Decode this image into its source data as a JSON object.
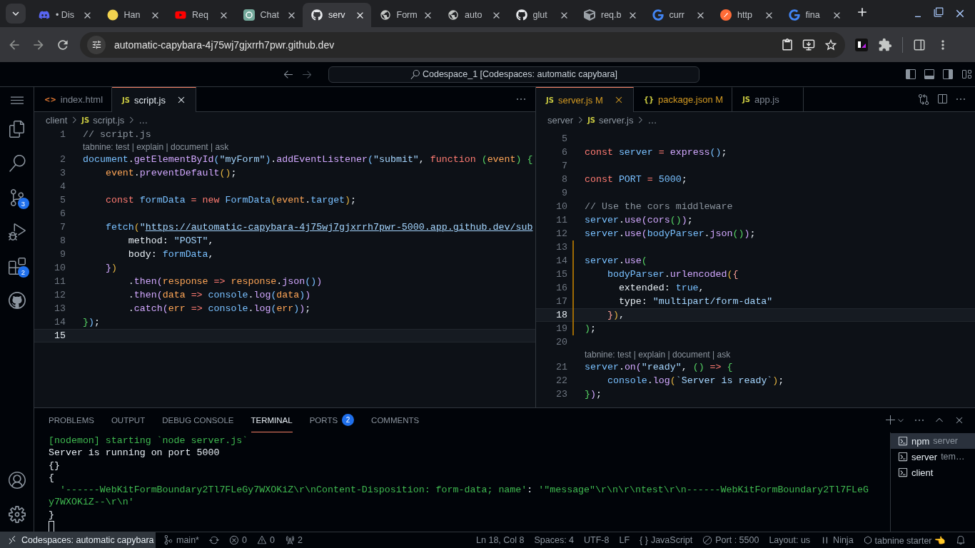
{
  "browser": {
    "tabs": [
      {
        "kind": "discord",
        "title": "• Dis",
        "selected": false
      },
      {
        "kind": "emoji",
        "title": "Han",
        "selected": false
      },
      {
        "kind": "youtube",
        "title": "Req",
        "selected": false
      },
      {
        "kind": "chat",
        "title": "Chat",
        "selected": false
      },
      {
        "kind": "github",
        "title": "serv",
        "selected": true
      },
      {
        "kind": "globe",
        "title": "Form",
        "selected": false
      },
      {
        "kind": "globe",
        "title": "auto",
        "selected": false
      },
      {
        "kind": "github",
        "title": "glut",
        "selected": false
      },
      {
        "kind": "cube",
        "title": "req.b",
        "selected": false
      },
      {
        "kind": "google",
        "title": "curr",
        "selected": false
      },
      {
        "kind": "postman",
        "title": "http",
        "selected": false
      },
      {
        "kind": "google",
        "title": "fina",
        "selected": false
      }
    ],
    "url": "automatic-capybara-4j75wj7gjxrrh7pwr.github.dev"
  },
  "titlebar": {
    "command_center": "Codespace_1 [Codespaces: automatic capybara]"
  },
  "activity_bar": {
    "top": [
      {
        "kind": "menu"
      },
      {
        "kind": "explorer"
      },
      {
        "kind": "search"
      },
      {
        "kind": "scm",
        "badge": "3"
      },
      {
        "kind": "debug"
      },
      {
        "kind": "extensions",
        "badge": "2"
      },
      {
        "kind": "github"
      }
    ],
    "bottom": [
      {
        "kind": "account"
      },
      {
        "kind": "settings"
      }
    ]
  },
  "editors": [
    {
      "tabs": [
        {
          "kind": "html",
          "icon": "<>",
          "label": "index.html",
          "selected": false
        },
        {
          "kind": "js",
          "icon": "JS",
          "label": "script.js",
          "selected": true
        }
      ],
      "breadcrumb": [
        {
          "text": "client"
        },
        {
          "icon": "JS",
          "text": "script.js"
        },
        {
          "text": "…"
        }
      ],
      "lines": [
        {
          "kind": "code",
          "number": "1",
          "current": false,
          "modified": false,
          "tokens": [
            {
              "text": "// script.js",
              "kind": "comment"
            }
          ]
        },
        {
          "kind": "lens",
          "text": "tabnine: test | explain | document | ask"
        },
        {
          "kind": "code",
          "number": "2",
          "current": false,
          "modified": false,
          "tokens": [
            {
              "text": "document",
              "kind": "var"
            },
            {
              "text": ".",
              "kind": "plain"
            },
            {
              "text": "getElementById",
              "kind": "func"
            },
            {
              "text": "(",
              "kind": "bracket1"
            },
            {
              "text": "\"myForm\"",
              "kind": "string"
            },
            {
              "text": ")",
              "kind": "bracket1"
            },
            {
              "text": ".",
              "kind": "plain"
            },
            {
              "text": "addEventListener",
              "kind": "func"
            },
            {
              "text": "(",
              "kind": "bracket1"
            },
            {
              "text": "\"submit\"",
              "kind": "string"
            },
            {
              "text": ", ",
              "kind": "plain"
            },
            {
              "text": "function ",
              "kind": "keyword"
            },
            {
              "text": "(",
              "kind": "bracket2"
            },
            {
              "text": "event",
              "kind": "param"
            },
            {
              "text": ") {",
              "kind": "bracket2"
            }
          ]
        },
        {
          "kind": "code",
          "number": "3",
          "current": false,
          "modified": false,
          "tokens": [
            {
              "text": "    event",
              "kind": "param"
            },
            {
              "text": ".",
              "kind": "plain"
            },
            {
              "text": "preventDefault",
              "kind": "func"
            },
            {
              "text": "()",
              "kind": "bracket3"
            },
            {
              "text": ";",
              "kind": "plain"
            }
          ]
        },
        {
          "kind": "code",
          "number": "4",
          "current": false,
          "modified": false
        },
        {
          "kind": "code",
          "number": "5",
          "current": false,
          "modified": false,
          "tokens": [
            {
              "text": "    const ",
              "kind": "keyword"
            },
            {
              "text": "formData",
              "kind": "var"
            },
            {
              "text": " = new ",
              "kind": "keyword"
            },
            {
              "text": "FormData",
              "kind": "var"
            },
            {
              "text": "(",
              "kind": "bracket3"
            },
            {
              "text": "event",
              "kind": "param"
            },
            {
              "text": ".",
              "kind": "plain"
            },
            {
              "text": "target",
              "kind": "var"
            },
            {
              "text": ")",
              "kind": "bracket3"
            },
            {
              "text": ";",
              "kind": "plain"
            }
          ]
        },
        {
          "kind": "code",
          "number": "6",
          "current": false,
          "modified": false
        },
        {
          "kind": "code",
          "number": "7",
          "current": false,
          "modified": false,
          "tokens": [
            {
              "text": "    fetch",
              "kind": "var"
            },
            {
              "text": "(",
              "kind": "bracket3"
            },
            {
              "text": "\"",
              "kind": "string"
            },
            {
              "text": "https://automatic-capybara-4j75wj7gjxrrh7pwr-5000.app.github.dev/sub",
              "kind": "link"
            }
          ]
        },
        {
          "kind": "code",
          "number": "8",
          "current": false,
          "modified": false,
          "tokens": [
            {
              "text": "        method: ",
              "kind": "plain"
            },
            {
              "text": "\"POST\"",
              "kind": "string"
            },
            {
              "text": ",",
              "kind": "plain"
            }
          ]
        },
        {
          "kind": "code",
          "number": "9",
          "current": false,
          "modified": false,
          "tokens": [
            {
              "text": "        body: ",
              "kind": "plain"
            },
            {
              "text": "formData",
              "kind": "var"
            },
            {
              "text": ",",
              "kind": "plain"
            }
          ]
        },
        {
          "kind": "code",
          "number": "10",
          "current": false,
          "modified": false,
          "tokens": [
            {
              "text": "    }",
              "kind": "bracket5"
            },
            {
              "text": ")",
              "kind": "bracket3"
            }
          ]
        },
        {
          "kind": "code",
          "number": "11",
          "current": false,
          "modified": false,
          "tokens": [
            {
              "text": "        .",
              "kind": "plain"
            },
            {
              "text": "then",
              "kind": "func"
            },
            {
              "text": "(",
              "kind": "bracket5"
            },
            {
              "text": "response",
              "kind": "param"
            },
            {
              "text": " => ",
              "kind": "keyword"
            },
            {
              "text": "response",
              "kind": "param"
            },
            {
              "text": ".",
              "kind": "plain"
            },
            {
              "text": "json",
              "kind": "func"
            },
            {
              "text": "()",
              "kind": "bracket1"
            },
            {
              "text": ")",
              "kind": "bracket5"
            }
          ]
        },
        {
          "kind": "code",
          "number": "12",
          "current": false,
          "modified": false,
          "tokens": [
            {
              "text": "        .",
              "kind": "plain"
            },
            {
              "text": "then",
              "kind": "func"
            },
            {
              "text": "(",
              "kind": "bracket5"
            },
            {
              "text": "data",
              "kind": "param"
            },
            {
              "text": " => ",
              "kind": "keyword"
            },
            {
              "text": "console",
              "kind": "var"
            },
            {
              "text": ".",
              "kind": "plain"
            },
            {
              "text": "log",
              "kind": "func"
            },
            {
              "text": "(",
              "kind": "bracket1"
            },
            {
              "text": "data",
              "kind": "param"
            },
            {
              "text": ")",
              "kind": "bracket1"
            },
            {
              "text": ")",
              "kind": "bracket5"
            }
          ]
        },
        {
          "kind": "code",
          "number": "13",
          "current": false,
          "modified": false,
          "tokens": [
            {
              "text": "        .",
              "kind": "plain"
            },
            {
              "text": "catch",
              "kind": "func"
            },
            {
              "text": "(",
              "kind": "bracket5"
            },
            {
              "text": "err",
              "kind": "param"
            },
            {
              "text": " => ",
              "kind": "keyword"
            },
            {
              "text": "console",
              "kind": "var"
            },
            {
              "text": ".",
              "kind": "plain"
            },
            {
              "text": "log",
              "kind": "func"
            },
            {
              "text": "(",
              "kind": "bracket1"
            },
            {
              "text": "err",
              "kind": "param"
            },
            {
              "text": ")",
              "kind": "bracket1"
            },
            {
              "text": ")",
              "kind": "bracket5"
            },
            {
              "text": ";",
              "kind": "plain"
            }
          ]
        },
        {
          "kind": "code",
          "number": "14",
          "current": false,
          "modified": false,
          "tokens": [
            {
              "text": "}",
              "kind": "bracket2"
            },
            {
              "text": ")",
              "kind": "bracket1"
            },
            {
              "text": ";",
              "kind": "plain"
            }
          ]
        },
        {
          "kind": "code",
          "number": "15",
          "current": true,
          "modified": false
        }
      ]
    },
    {
      "tabs": [
        {
          "kind": "js",
          "icon": "JS",
          "label": "server.js",
          "status": "M",
          "selected": true
        },
        {
          "kind": "json",
          "icon": "{}",
          "label": "package.json",
          "status": "M",
          "selected": false
        },
        {
          "kind": "js",
          "icon": "JS",
          "label": "app.js",
          "selected": false
        }
      ],
      "breadcrumb": [
        {
          "text": "server"
        },
        {
          "icon": "JS",
          "text": "server.js"
        },
        {
          "text": "…"
        }
      ],
      "lines": [
        {
          "kind": "code",
          "number": "5",
          "current": false,
          "modified": false
        },
        {
          "kind": "code",
          "number": "6",
          "current": false,
          "modified": false,
          "tokens": [
            {
              "text": "const ",
              "kind": "keyword"
            },
            {
              "text": "server",
              "kind": "var"
            },
            {
              "text": " = ",
              "kind": "keyword"
            },
            {
              "text": "express",
              "kind": "func"
            },
            {
              "text": "()",
              "kind": "bracket1"
            },
            {
              "text": ";",
              "kind": "plain"
            }
          ]
        },
        {
          "kind": "code",
          "number": "7",
          "current": false,
          "modified": false
        },
        {
          "kind": "code",
          "number": "8",
          "current": false,
          "modified": false,
          "tokens": [
            {
              "text": "const ",
              "kind": "keyword"
            },
            {
              "text": "PORT",
              "kind": "var"
            },
            {
              "text": " = ",
              "kind": "keyword"
            },
            {
              "text": "5000",
              "kind": "var"
            },
            {
              "text": ";",
              "kind": "plain"
            }
          ]
        },
        {
          "kind": "code",
          "number": "9",
          "current": false,
          "modified": false
        },
        {
          "kind": "code",
          "number": "10",
          "current": false,
          "modified": false,
          "tokens": [
            {
              "text": "// Use the cors middleware",
              "kind": "comment"
            }
          ]
        },
        {
          "kind": "code",
          "number": "11",
          "current": false,
          "modified": false,
          "tokens": [
            {
              "text": "server",
              "kind": "var"
            },
            {
              "text": ".",
              "kind": "plain"
            },
            {
              "text": "use",
              "kind": "func"
            },
            {
              "text": "(",
              "kind": "bracket5"
            },
            {
              "text": "cors",
              "kind": "func"
            },
            {
              "text": "()",
              "kind": "bracket2"
            },
            {
              "text": ")",
              "kind": "bracket5"
            },
            {
              "text": ";",
              "kind": "plain"
            }
          ]
        },
        {
          "kind": "code",
          "number": "12",
          "current": false,
          "modified": false,
          "tokens": [
            {
              "text": "server",
              "kind": "var"
            },
            {
              "text": ".",
              "kind": "plain"
            },
            {
              "text": "use",
              "kind": "func"
            },
            {
              "text": "(",
              "kind": "bracket5"
            },
            {
              "text": "bodyParser",
              "kind": "var"
            },
            {
              "text": ".",
              "kind": "plain"
            },
            {
              "text": "json",
              "kind": "func"
            },
            {
              "text": "()",
              "kind": "bracket2"
            },
            {
              "text": ")",
              "kind": "bracket5"
            },
            {
              "text": ";",
              "kind": "plain"
            }
          ]
        },
        {
          "kind": "code",
          "number": "13",
          "current": false,
          "modified": true
        },
        {
          "kind": "code",
          "number": "14",
          "current": false,
          "modified": true,
          "tokens": [
            {
              "text": "server",
              "kind": "var"
            },
            {
              "text": ".",
              "kind": "plain"
            },
            {
              "text": "use",
              "kind": "func"
            },
            {
              "text": "(",
              "kind": "bracket2"
            }
          ]
        },
        {
          "kind": "code",
          "number": "15",
          "current": false,
          "modified": true,
          "tokens": [
            {
              "text": "    bodyParser",
              "kind": "var"
            },
            {
              "text": ".",
              "kind": "plain"
            },
            {
              "text": "urlencoded",
              "kind": "func"
            },
            {
              "text": "(",
              "kind": "bracket3"
            },
            {
              "text": "{",
              "kind": "bracket4"
            }
          ]
        },
        {
          "kind": "code",
          "number": "16",
          "current": false,
          "modified": true,
          "tokens": [
            {
              "text": "      extended: ",
              "kind": "plain"
            },
            {
              "text": "true",
              "kind": "var"
            },
            {
              "text": ",",
              "kind": "plain"
            }
          ]
        },
        {
          "kind": "code",
          "number": "17",
          "current": false,
          "modified": true,
          "tokens": [
            {
              "text": "      type: ",
              "kind": "plain"
            },
            {
              "text": "\"multipart/form-data\"",
              "kind": "string"
            }
          ]
        },
        {
          "kind": "code",
          "number": "18",
          "current": true,
          "modified": true,
          "tokens": [
            {
              "text": "    }",
              "kind": "bracket4"
            },
            {
              "text": ")",
              "kind": "bracket3"
            },
            {
              "text": ",",
              "kind": "plain"
            }
          ]
        },
        {
          "kind": "code",
          "number": "19",
          "current": false,
          "modified": true,
          "tokens": [
            {
              "text": ")",
              "kind": "bracket2"
            },
            {
              "text": ";",
              "kind": "plain"
            }
          ]
        },
        {
          "kind": "code",
          "number": "20",
          "current": false,
          "modified": false
        },
        {
          "kind": "lens",
          "text": "tabnine: test | explain | document | ask"
        },
        {
          "kind": "code",
          "number": "21",
          "current": false,
          "modified": false,
          "tokens": [
            {
              "text": "server",
              "kind": "var"
            },
            {
              "text": ".",
              "kind": "plain"
            },
            {
              "text": "on",
              "kind": "func"
            },
            {
              "text": "(",
              "kind": "bracket5"
            },
            {
              "text": "\"ready\"",
              "kind": "string"
            },
            {
              "text": ", ",
              "kind": "plain"
            },
            {
              "text": "()",
              "kind": "bracket2"
            },
            {
              "text": " => ",
              "kind": "keyword"
            },
            {
              "text": "{",
              "kind": "bracket2"
            }
          ]
        },
        {
          "kind": "code",
          "number": "22",
          "current": false,
          "modified": false,
          "tokens": [
            {
              "text": "    console",
              "kind": "var"
            },
            {
              "text": ".",
              "kind": "plain"
            },
            {
              "text": "log",
              "kind": "func"
            },
            {
              "text": "(",
              "kind": "bracket3"
            },
            {
              "text": "`Server is ready`",
              "kind": "string"
            },
            {
              "text": ")",
              "kind": "bracket3"
            },
            {
              "text": ";",
              "kind": "plain"
            }
          ]
        },
        {
          "kind": "code",
          "number": "23",
          "current": false,
          "modified": false,
          "tokens": [
            {
              "text": "}",
              "kind": "bracket2"
            },
            {
              "text": ")",
              "kind": "bracket5"
            },
            {
              "text": ";",
              "kind": "plain"
            }
          ]
        }
      ]
    }
  ],
  "panel": {
    "tabs": [
      {
        "label": "PROBLEMS",
        "selected": false
      },
      {
        "label": "OUTPUT",
        "selected": false
      },
      {
        "label": "DEBUG CONSOLE",
        "selected": false
      },
      {
        "label": "TERMINAL",
        "selected": true
      },
      {
        "label": "PORTS",
        "badge": "2",
        "selected": false
      },
      {
        "label": "COMMENTS",
        "selected": false
      }
    ],
    "terminal_lines": [
      [
        {
          "text": "[nodemon] starting `node server.js`",
          "kind": "green"
        }
      ],
      [
        {
          "text": "Server is running on port 5000",
          "kind": "plain"
        }
      ],
      [
        {
          "text": "{}",
          "kind": "plain"
        }
      ],
      [
        {
          "text": "{",
          "kind": "plain"
        }
      ],
      [
        {
          "text": "  '------WebKitFormBoundary2Tl7FLeGy7WXOKiZ\\r\\nContent-Disposition: form-data; name'",
          "kind": "green"
        },
        {
          "text": ": ",
          "kind": "plain"
        },
        {
          "text": "'\"message\"\\r\\n\\r\\ntest\\r\\n------WebKitFormBoundary2Tl7FLeG",
          "kind": "green"
        }
      ],
      [
        {
          "text": "y7WXOKiZ--\\r\\n'",
          "kind": "green"
        }
      ],
      [
        {
          "text": "}",
          "kind": "plain"
        }
      ]
    ],
    "terminals": [
      {
        "name": "npm",
        "detail": "server",
        "selected": true
      },
      {
        "name": "server",
        "detail": "tem…",
        "selected": false
      },
      {
        "name": "client",
        "selected": false
      }
    ]
  },
  "status_bar": {
    "remote": "Codespaces: automatic capybara",
    "left": [
      {
        "kind": "branch",
        "text": "main*"
      },
      {
        "kind": "sync"
      },
      {
        "kind": "errors",
        "text": "0"
      },
      {
        "kind": "warnings",
        "text": "0"
      },
      {
        "kind": "ports",
        "text": "2"
      }
    ],
    "right": [
      {
        "kind": "text",
        "text": "Ln 18, Col 8"
      },
      {
        "kind": "text",
        "text": "Spaces: 4"
      },
      {
        "kind": "text",
        "text": "UTF-8"
      },
      {
        "kind": "text",
        "text": "LF"
      },
      {
        "kind": "language",
        "icon": "{ }",
        "text": "JavaScript"
      },
      {
        "kind": "port",
        "text": "Port : 5500"
      },
      {
        "kind": "text",
        "text": "Layout: us"
      },
      {
        "kind": "pause",
        "text": "Ninja"
      },
      {
        "kind": "tabnine",
        "text": "tabnine starter 👈"
      },
      {
        "kind": "bell"
      }
    ]
  }
}
